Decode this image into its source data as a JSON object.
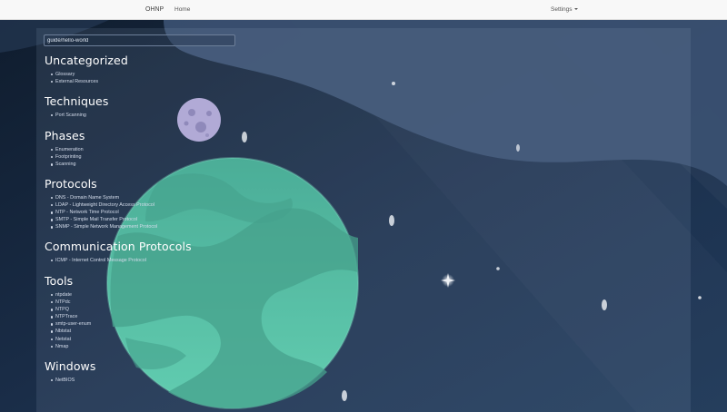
{
  "navbar": {
    "brand": "OHNP",
    "home": "Home",
    "settings": "Settings"
  },
  "search": {
    "value": "guide/hello-world"
  },
  "sections": [
    {
      "title": "Uncategorized",
      "items": [
        "Glossary",
        "External Resources"
      ]
    },
    {
      "title": "Techniques",
      "items": [
        "Port Scanning"
      ]
    },
    {
      "title": "Phases",
      "items": [
        "Enumeration",
        "Footprinting",
        "Scanning"
      ]
    },
    {
      "title": "Protocols",
      "items": [
        "DNS - Domain Name System",
        "LDAP - Lightweight Directory Access Protocol",
        "NTP - Network Time Protocol",
        "SMTP - Simple Mail Transfer Protocol",
        "SNMP - Simple Network Management Protocol"
      ]
    },
    {
      "title": "Communication Protocols",
      "items": [
        "ICMP - Internet Control Message Protocol"
      ]
    },
    {
      "title": "Tools",
      "items": [
        "ntpdate",
        "NTPdc",
        "NTPQ",
        "NTPTrace",
        "smtp-user-enum",
        "Nbtstat",
        "Netstat",
        "Nmap"
      ]
    },
    {
      "title": "Windows",
      "items": [
        "NetBIOS"
      ]
    }
  ],
  "colors": {
    "background": "#15243a",
    "planet": "#4cc9a4",
    "moon": "#b3a8d6",
    "navbar": "#f8f8f8"
  }
}
